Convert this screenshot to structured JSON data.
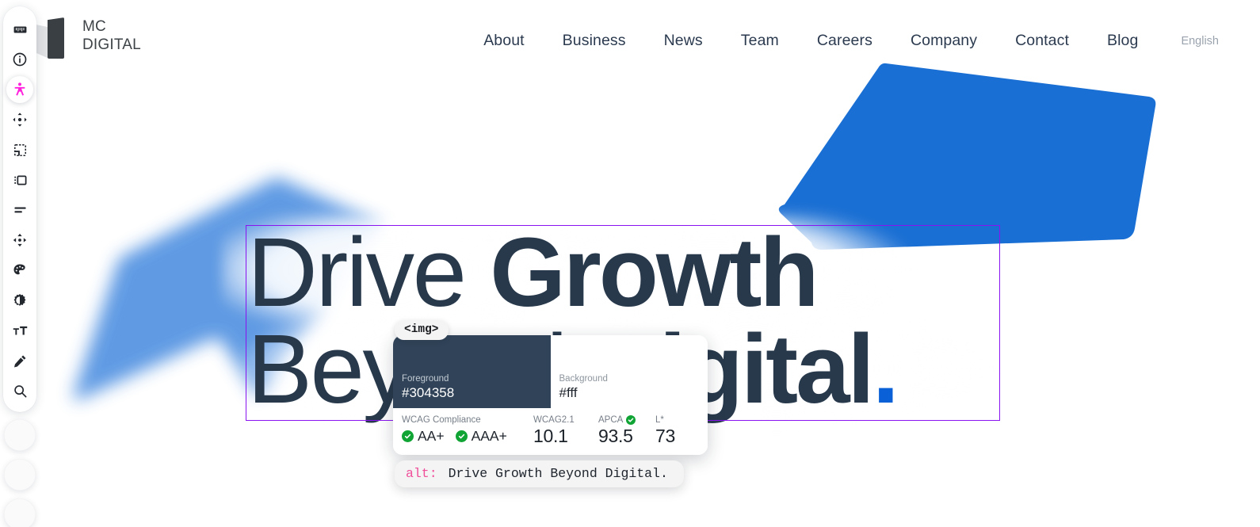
{
  "colors": {
    "foreground": "#304358",
    "background": "#ffffff",
    "accent_blue": "#1a6fd4",
    "dot_blue": "#0a60d6",
    "selection_outline": "#8a14f0",
    "a11y_active": "#ff22dd",
    "pass_green": "#10a435",
    "alt_key_pink": "#f0509a"
  },
  "header": {
    "brand": {
      "logo_icon": "mc-digital-logomark",
      "name": "MC\nDIGITAL"
    },
    "nav": [
      {
        "label": "About"
      },
      {
        "label": "Business"
      },
      {
        "label": "News"
      },
      {
        "label": "Team"
      },
      {
        "label": "Careers"
      },
      {
        "label": "Company"
      },
      {
        "label": "Contact"
      },
      {
        "label": "Blog"
      }
    ],
    "language": {
      "label": "English"
    }
  },
  "hero": {
    "line1_light": "Drive ",
    "line1_bold": "Growth",
    "line2_light": "Beyond ",
    "line2_bold": "Digital",
    "line2_dot": "."
  },
  "a11y_toolbar": {
    "tools": [
      {
        "icon": "ruler-icon",
        "name": "measure-tool",
        "active": false
      },
      {
        "icon": "info-circle-icon",
        "name": "info-tool",
        "active": false
      },
      {
        "icon": "accessibility-icon",
        "name": "accessibility-tool",
        "active": true
      },
      {
        "icon": "move-arrows-icon",
        "name": "move-tool",
        "active": false
      },
      {
        "icon": "select-region-icon",
        "name": "select-region-tool",
        "active": false
      },
      {
        "icon": "frame-icon",
        "name": "frame-tool",
        "active": false
      },
      {
        "icon": "lines-icon",
        "name": "spacing-tool",
        "active": false
      },
      {
        "icon": "dpad-icon",
        "name": "nudge-tool",
        "active": false
      },
      {
        "icon": "palette-icon",
        "name": "palette-tool",
        "active": false
      },
      {
        "icon": "contrast-icon",
        "name": "contrast-tool",
        "active": false
      },
      {
        "icon": "text-size-icon",
        "name": "text-size-tool",
        "active": false
      },
      {
        "icon": "pencil-icon",
        "name": "edit-tool",
        "active": false
      },
      {
        "icon": "search-icon",
        "name": "zoom-tool",
        "active": false
      }
    ],
    "extra_slots": [
      {
        "name": "empty-slot-1"
      },
      {
        "name": "empty-slot-2"
      },
      {
        "name": "empty-slot-3"
      }
    ]
  },
  "inspector": {
    "element_tag": "<img>",
    "foreground": {
      "label": "Foreground",
      "value": "#304358"
    },
    "background": {
      "label": "Background",
      "value": "#fff"
    },
    "wcag_compliance": {
      "label": "WCAG Compliance",
      "badges": [
        {
          "label": "AA+",
          "status": "pass"
        },
        {
          "label": "AAA+",
          "status": "pass"
        }
      ]
    },
    "wcag21": {
      "label": "WCAG2.1",
      "value": "10.1"
    },
    "apca": {
      "label": "APCA",
      "value": "93.5",
      "status": "pass"
    },
    "lstar": {
      "label": "L*",
      "value": "73"
    },
    "alt": {
      "key": "alt:",
      "value": "Drive Growth Beyond Digital."
    }
  }
}
